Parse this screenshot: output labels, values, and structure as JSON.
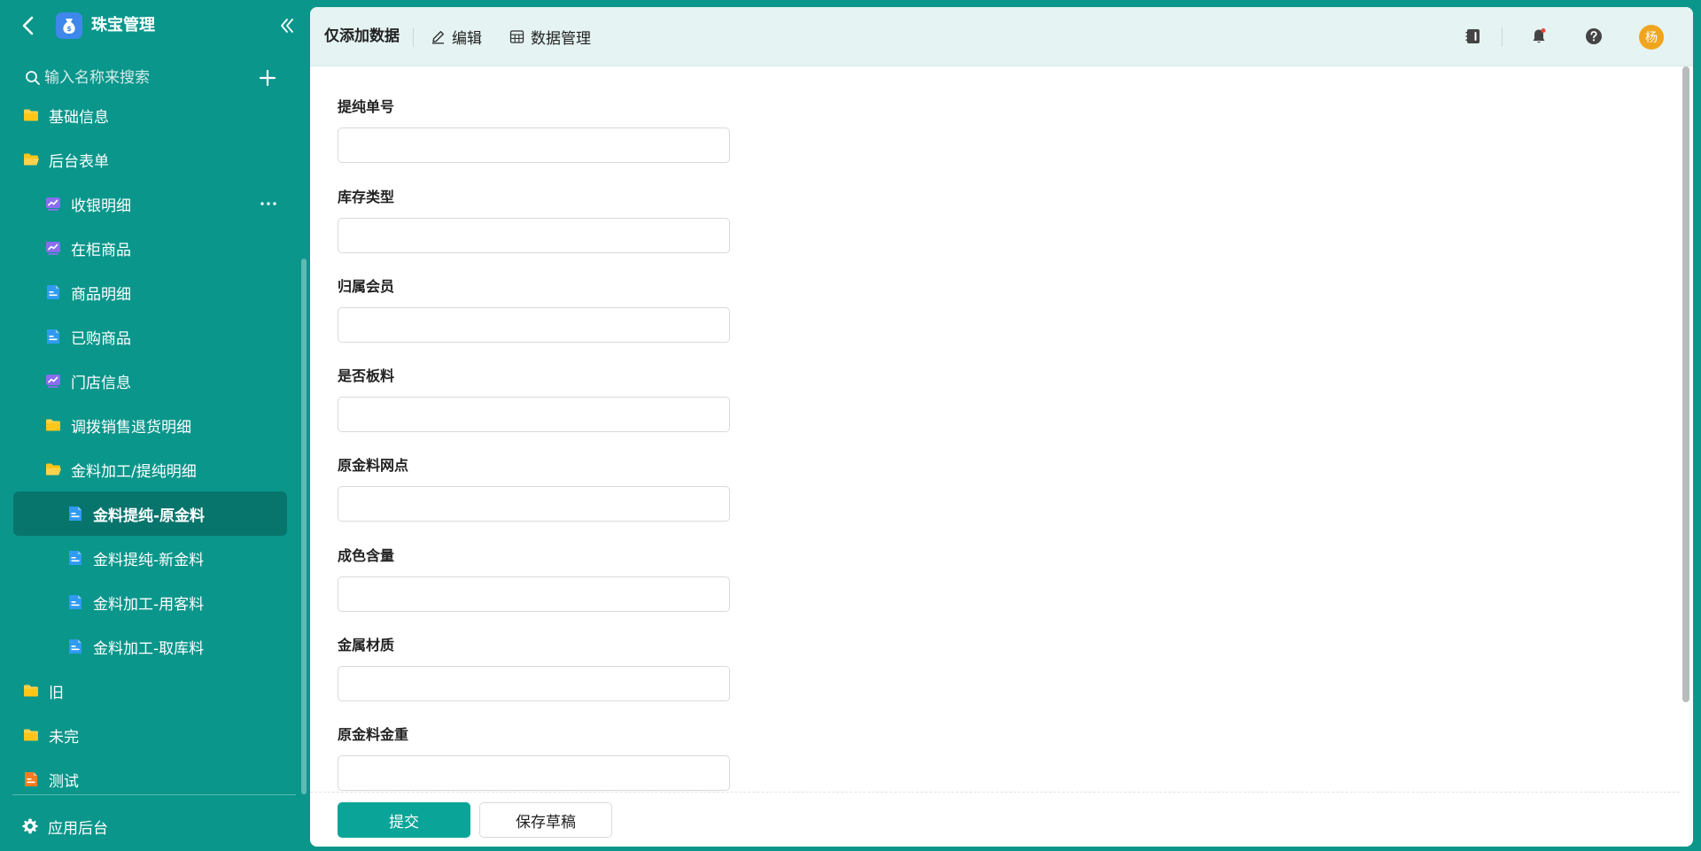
{
  "app": {
    "title": "珠宝管理",
    "accent_color": "#0a968b",
    "icons": {
      "back": "chevron-left-icon",
      "logo": "money-bag-icon",
      "collapse": "double-chevron-left-icon"
    }
  },
  "search": {
    "placeholder": "输入名称来搜索"
  },
  "sidebar": {
    "items": [
      {
        "label": "基础信息",
        "icon": "folder-icon"
      },
      {
        "label": "后台表单",
        "icon": "folder-open-icon"
      },
      {
        "label": "收银明细",
        "icon": "chart-icon"
      },
      {
        "label": "在柜商品",
        "icon": "chart-icon"
      },
      {
        "label": "商品明细",
        "icon": "form-icon"
      },
      {
        "label": "已购商品",
        "icon": "form-icon"
      },
      {
        "label": "门店信息",
        "icon": "chart-icon"
      },
      {
        "label": "调拨销售退货明细",
        "icon": "folder-icon"
      },
      {
        "label": "金料加工/提纯明细",
        "icon": "folder-open-icon"
      },
      {
        "label": "金料提纯-原金料",
        "icon": "form-icon",
        "active": true
      },
      {
        "label": "金料提纯-新金料",
        "icon": "form-icon"
      },
      {
        "label": "金料加工-用客料",
        "icon": "form-icon"
      },
      {
        "label": "金料加工-取库料",
        "icon": "form-icon"
      },
      {
        "label": "旧",
        "icon": "folder-icon"
      },
      {
        "label": "未完",
        "icon": "folder-icon"
      },
      {
        "label": "测试",
        "icon": "form-orange-icon"
      }
    ],
    "footer_label": "应用后台"
  },
  "toolbar": {
    "title": "仅添加数据",
    "edit_label": "编辑",
    "data_label": "数据管理",
    "avatar_text": "杨"
  },
  "form": {
    "fields": [
      {
        "label": "提纯单号",
        "value": ""
      },
      {
        "label": "库存类型",
        "value": ""
      },
      {
        "label": "归属会员",
        "value": ""
      },
      {
        "label": "是否板料",
        "value": ""
      },
      {
        "label": "原金料网点",
        "value": ""
      },
      {
        "label": "成色含量",
        "value": ""
      },
      {
        "label": "金属材质",
        "value": ""
      },
      {
        "label": "原金料金重",
        "value": ""
      }
    ],
    "submit_label": "提交",
    "draft_label": "保存草稿"
  }
}
